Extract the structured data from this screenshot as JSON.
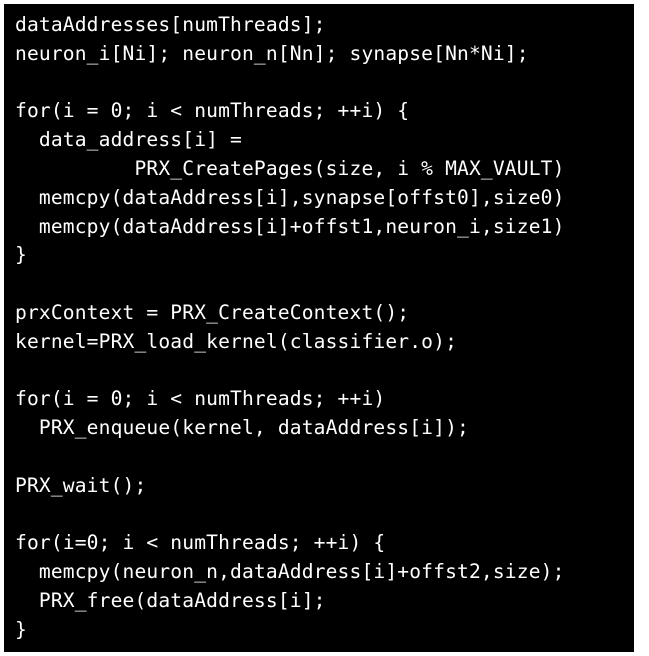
{
  "code": {
    "lines": [
      "dataAddresses[numThreads];",
      "neuron_i[Ni]; neuron_n[Nn]; synapse[Nn*Ni];",
      "",
      "for(i = 0; i < numThreads; ++i) {",
      "  data_address[i] =",
      "          PRX_CreatePages(size, i % MAX_VAULT)",
      "  memcpy(dataAddress[i],synapse[offst0],size0)",
      "  memcpy(dataAddress[i]+offst1,neuron_i,size1)",
      "}",
      "",
      "prxContext = PRX_CreateContext();",
      "kernel=PRX_load_kernel(classifier.o);",
      "",
      "for(i = 0; i < numThreads; ++i)",
      "  PRX_enqueue(kernel, dataAddress[i]);",
      "",
      "PRX_wait();",
      "",
      "for(i=0; i < numThreads; ++i) {",
      "  memcpy(neuron_n,dataAddress[i]+offst2,size);",
      "  PRX_free(dataAddress[i];",
      "}"
    ]
  }
}
